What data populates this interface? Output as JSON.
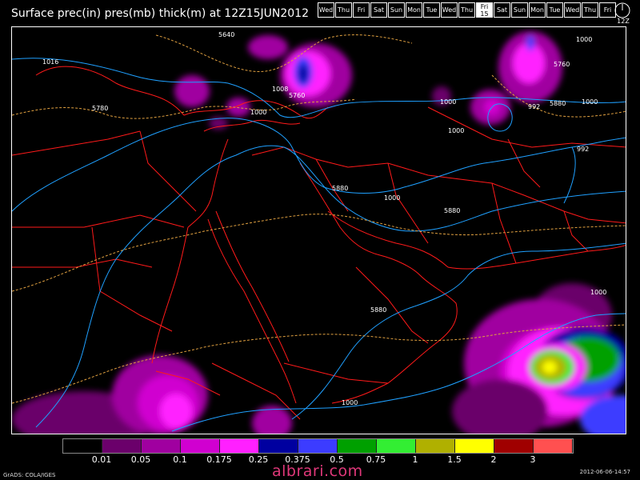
{
  "title": "Surface prec(in) pres(mb) thick(m) at 12Z15JUN2012",
  "days": [
    {
      "label": "Wed",
      "active": false
    },
    {
      "label": "Thu",
      "active": false
    },
    {
      "label": "Fri",
      "active": false
    },
    {
      "label": "Sat",
      "active": false
    },
    {
      "label": "Sun",
      "active": false
    },
    {
      "label": "Mon",
      "active": false
    },
    {
      "label": "Tue",
      "active": false
    },
    {
      "label": "Wed",
      "active": false
    },
    {
      "label": "Thu",
      "active": false
    },
    {
      "label": "Fri",
      "active": true,
      "sub": "15"
    },
    {
      "label": "Sat",
      "active": false
    },
    {
      "label": "Sun",
      "active": false
    },
    {
      "label": "Mon",
      "active": false
    },
    {
      "label": "Tue",
      "active": false
    },
    {
      "label": "Wed",
      "active": false
    },
    {
      "label": "Thu",
      "active": false
    },
    {
      "label": "Fri",
      "active": false
    }
  ],
  "clock_label": "12Z",
  "colors": {
    "coastline": "#ff1a1a",
    "isobar": "#1fa0ff",
    "thickness": "#e0a040",
    "frame": "#ffffff"
  },
  "contour_labels": [
    {
      "text": "5640"
    },
    {
      "text": "1016"
    },
    {
      "text": "1008"
    },
    {
      "text": "5760"
    },
    {
      "text": "5780"
    },
    {
      "text": "1000"
    },
    {
      "text": "1000"
    },
    {
      "text": "1000"
    },
    {
      "text": "5880"
    },
    {
      "text": "1000"
    },
    {
      "text": "5880"
    },
    {
      "text": "1000"
    },
    {
      "text": "992"
    },
    {
      "text": "5880"
    },
    {
      "text": "1000"
    },
    {
      "text": "992"
    },
    {
      "text": "5760"
    },
    {
      "text": "1000"
    },
    {
      "text": "5880"
    },
    {
      "text": "1000"
    }
  ],
  "legend": {
    "colors": [
      "#000000",
      "#6b006b",
      "#a000a0",
      "#d000d0",
      "#ff20ff",
      "#0000a0",
      "#3c3cff",
      "#00a000",
      "#33ee33",
      "#b0b000",
      "#ffff00",
      "#a00000",
      "#ff5050"
    ],
    "labels": [
      "0.01",
      "0.05",
      "0.1",
      "0.175",
      "0.25",
      "0.375",
      "0.5",
      "0.75",
      "1",
      "1.5",
      "2",
      "3"
    ]
  },
  "footer_left": "GrADS: COLA/IGES",
  "footer_right": "2012-06-06-14:57",
  "brand": "albrari.com"
}
